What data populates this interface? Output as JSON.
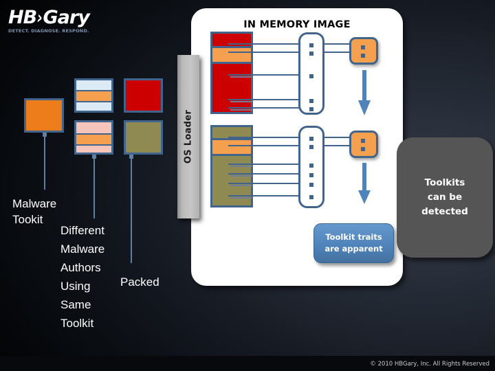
{
  "brand": {
    "name_part1": "HB",
    "chevron": "›",
    "name_part2": "Gary",
    "tagline": "DETECT.  DIAGNOSE.  RESPOND."
  },
  "panel": {
    "title": "IN MEMORY IMAGE"
  },
  "os_loader": {
    "label": "OS Loader"
  },
  "callouts": {
    "toolkit_traits": "Toolkit traits\nare apparent",
    "toolkits_detected": "Toolkits\ncan be\ndetected"
  },
  "labels": {
    "malware_toolkit": "Malware\nTookit",
    "different_authors": "Different\nMalware\nAuthors\nUsing\nSame\nToolkit",
    "packed": "Packed"
  },
  "footer": {
    "copyright": "© 2010 HBGary, Inc. All Rights Reserved"
  },
  "colors": {
    "orange": "#f5a04e",
    "orange_solid": "#ed7d1a",
    "red": "#cc0000",
    "olive": "#8f8a51",
    "outline_blue": "#41648c",
    "light_blue_stripe": "#dceaf5",
    "pink_stripe": "#f5c4bb",
    "arrow_blue": "#4f84bb",
    "gray_callout": "#555555",
    "blue_callout": "#4f84bb",
    "panel_white": "#ffffff"
  },
  "diagram": {
    "samples": [
      {
        "name": "malware-toolkit-sample",
        "fill": "#ed7d1a",
        "stripes": []
      },
      {
        "name": "author-sample-1",
        "stripes": [
          "#dceaf5",
          "#f5a04e",
          "#dceaf5"
        ]
      },
      {
        "name": "author-sample-2",
        "stripes": [
          "#f5c4bb",
          "#f5a04e",
          "#f5c4bb"
        ]
      },
      {
        "name": "packed-sample-red",
        "fill": "#cc0000",
        "stripes": []
      },
      {
        "name": "packed-sample-olive",
        "fill": "#8f8a51",
        "stripes": []
      }
    ],
    "memory_blocks": [
      {
        "name": "memory-block-red",
        "body_fill": "#cc0000",
        "band_fill": "#f5a04e",
        "tick_count": 3
      },
      {
        "name": "memory-block-olive",
        "body_fill": "#8f8a51",
        "band_fill": "#f5a04e",
        "tick_count": 4
      }
    ],
    "capsules": [
      {
        "name": "trait-capsule-upper",
        "dot_count": 5
      },
      {
        "name": "trait-capsule-lower",
        "dot_count": 5
      }
    ],
    "orange_nodes": [
      {
        "name": "toolkit-node-upper",
        "dot_count": 2
      },
      {
        "name": "toolkit-node-lower",
        "dot_count": 2
      }
    ]
  }
}
